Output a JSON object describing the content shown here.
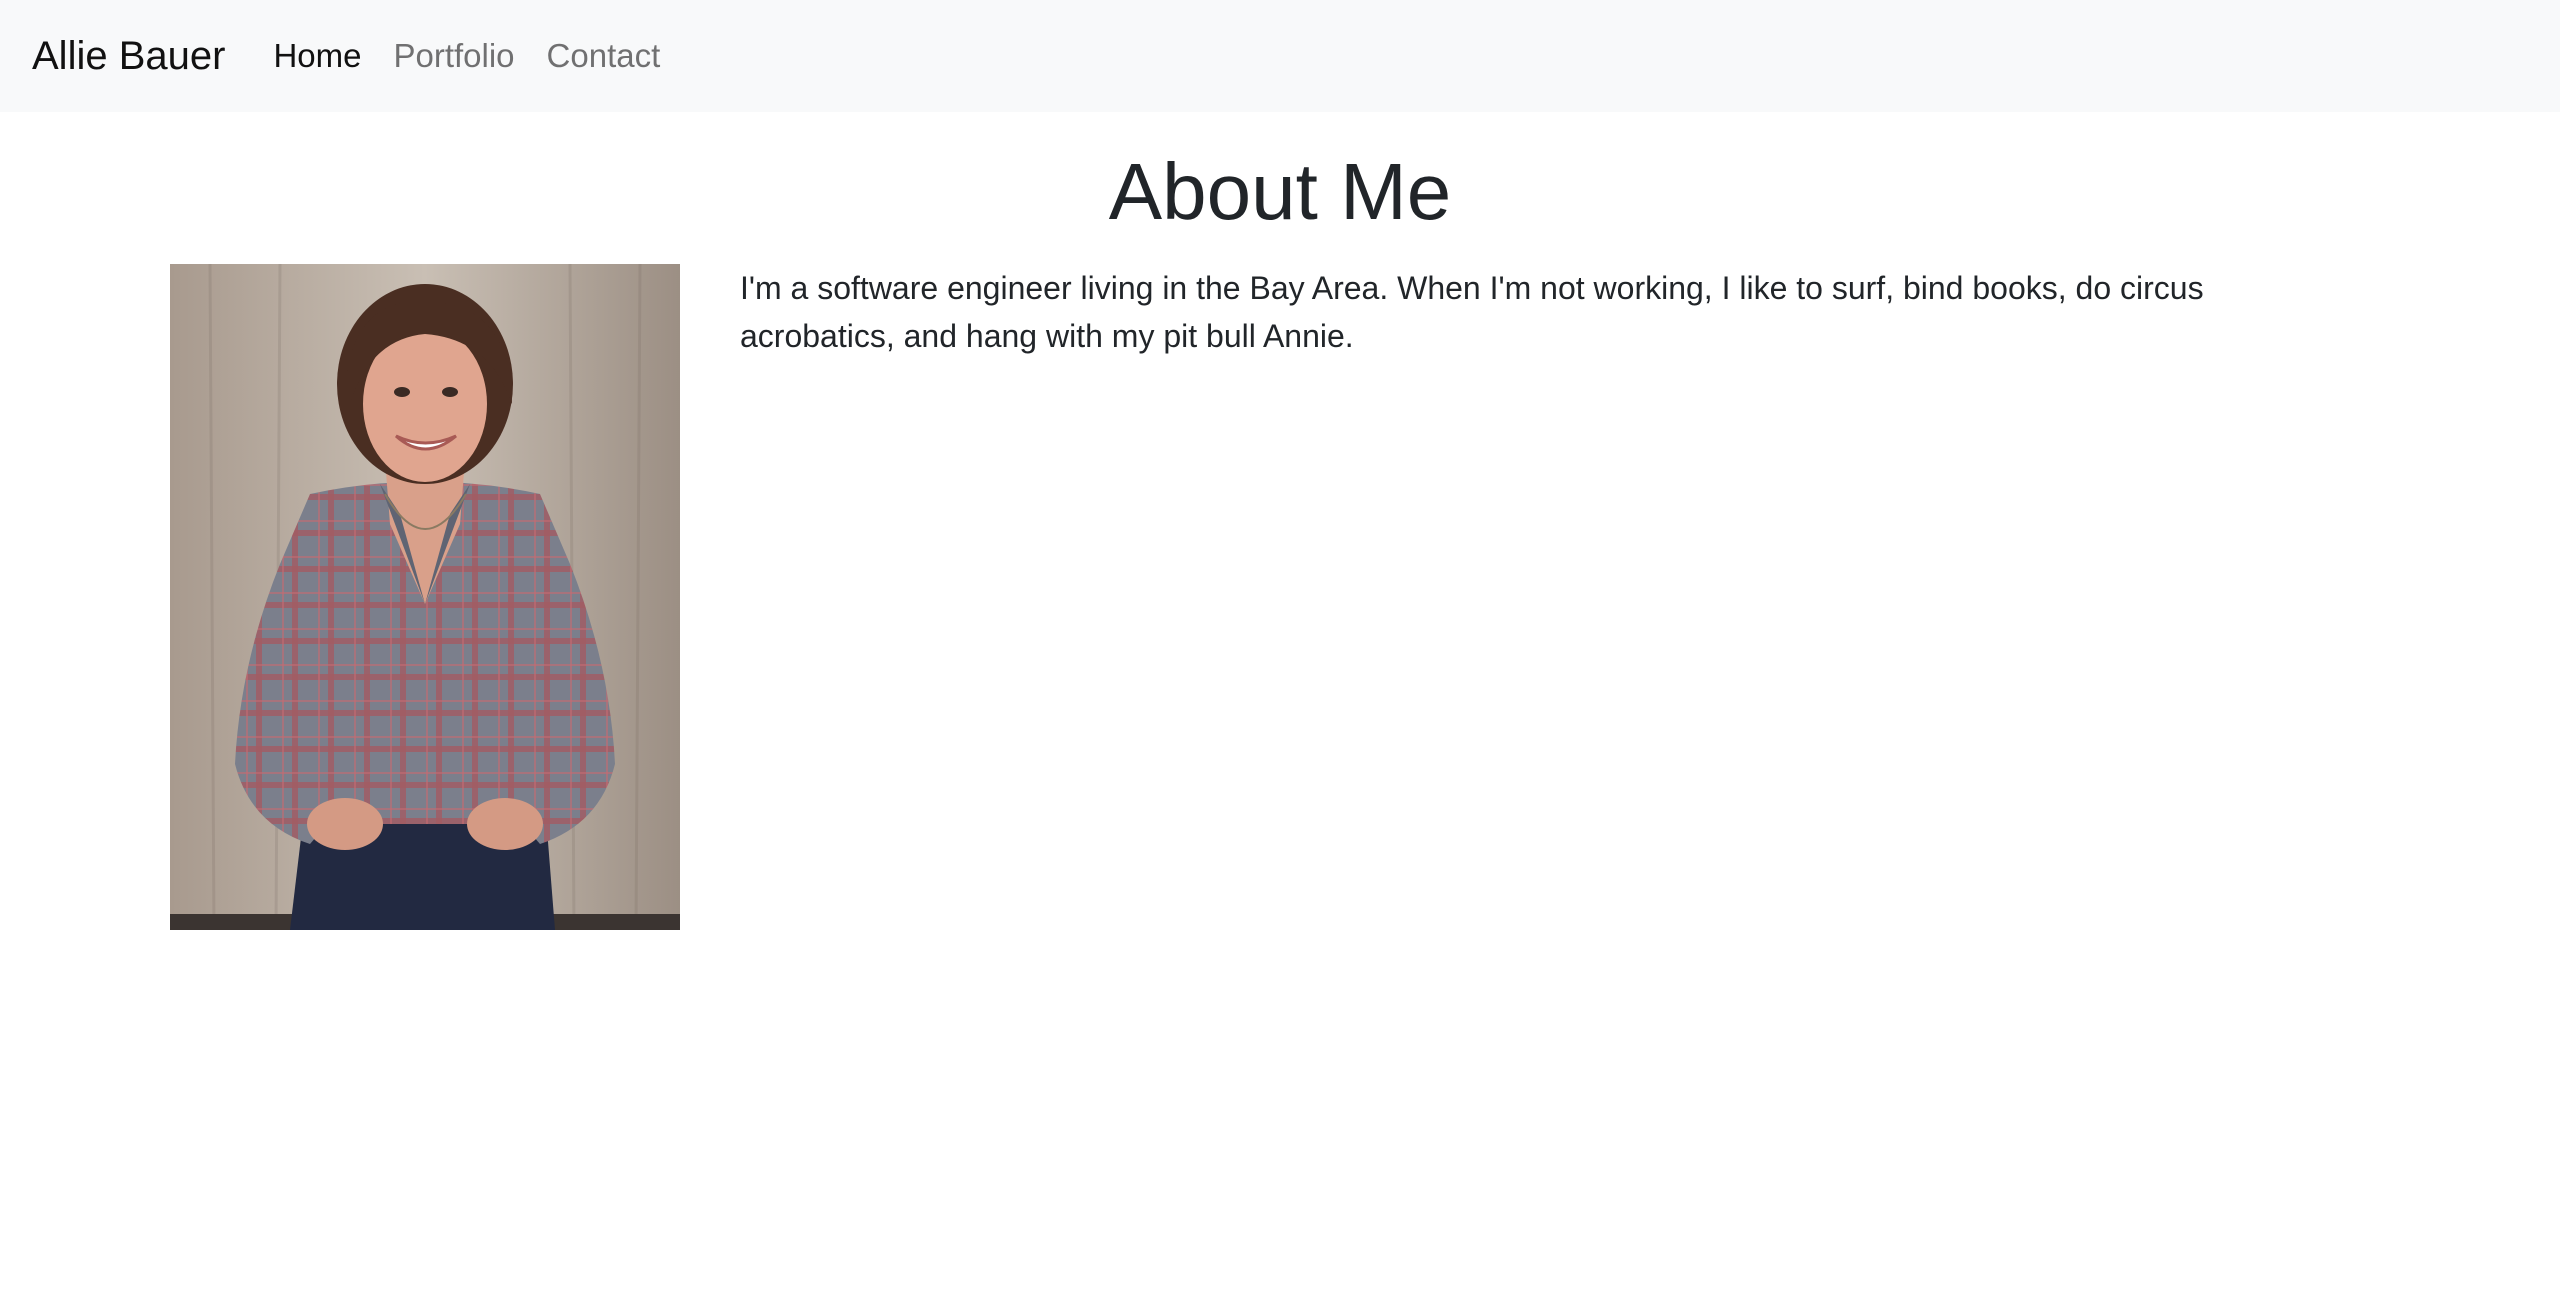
{
  "navbar": {
    "brand": "Allie Bauer",
    "links": [
      {
        "label": "Home",
        "active": true
      },
      {
        "label": "Portfolio",
        "active": false
      },
      {
        "label": "Contact",
        "active": false
      }
    ]
  },
  "main": {
    "title": "About Me",
    "bio": "I'm a software engineer living in the Bay Area. When I'm not working, I like to surf, bind books, do circus acrobatics, and hang with my pit bull Annie."
  },
  "colors": {
    "navbar_bg": "#f8f9fa",
    "text": "#212529",
    "muted_link": "#7f7f7f"
  }
}
